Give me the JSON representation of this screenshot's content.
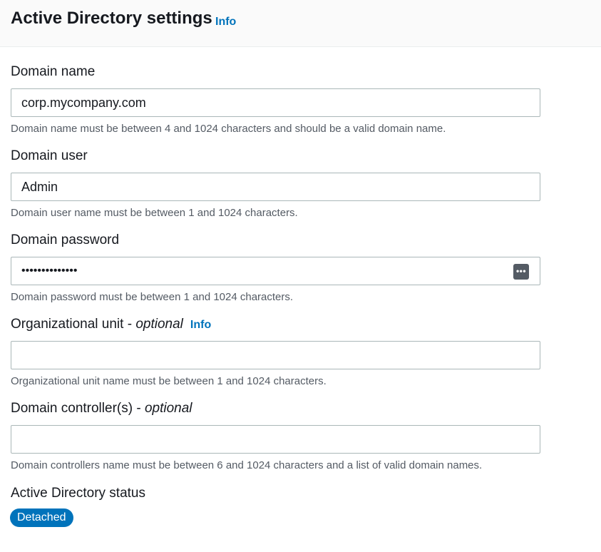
{
  "header": {
    "title": "Active Directory settings",
    "info_label": "Info"
  },
  "fields": {
    "domain_name": {
      "label": "Domain name",
      "value": "corp.mycompany.com",
      "hint": "Domain name must be between 4 and 1024 characters and should be a valid domain name."
    },
    "domain_user": {
      "label": "Domain user",
      "value": "Admin",
      "hint": "Domain user name must be between 1 and 1024 characters."
    },
    "domain_password": {
      "label": "Domain password",
      "value": "••••••••••••••",
      "hint": "Domain password must be between 1 and 1024 characters.",
      "icon": "show-password-icon"
    },
    "organizational_unit": {
      "label": "Organizational unit - ",
      "optional": "optional",
      "info_label": "Info",
      "value": "",
      "hint": "Organizational unit name must be between 1 and 1024 characters."
    },
    "domain_controllers": {
      "label": "Domain controller(s) - ",
      "optional": "optional",
      "value": "",
      "hint": "Domain controllers name must be between 6 and 1024 characters and a list of valid domain names."
    }
  },
  "status": {
    "label": "Active Directory status",
    "badge": "Detached",
    "badge_color": "#0073bb"
  },
  "colors": {
    "link": "#0073bb",
    "hint_text": "#545b64",
    "input_border": "#aab7b8"
  }
}
